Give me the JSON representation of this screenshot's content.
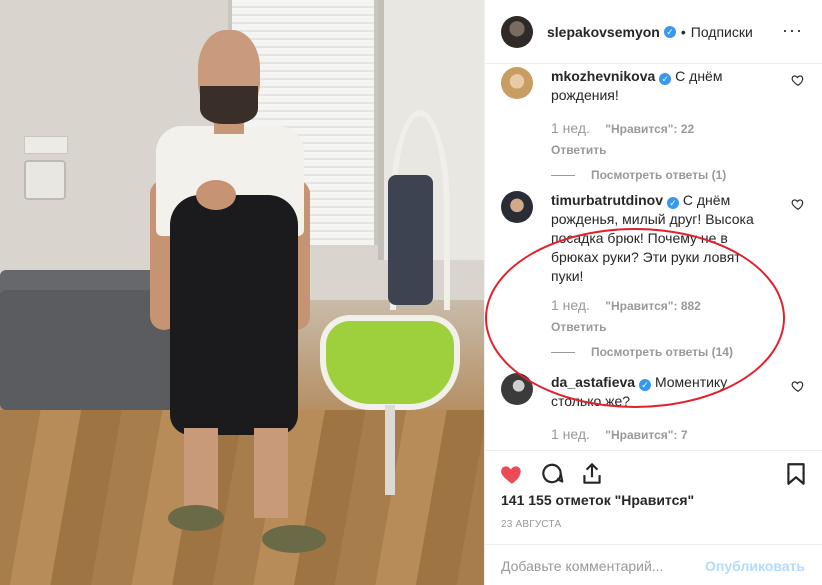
{
  "post": {
    "author": "slepakovsemyon",
    "follow_label": "Подписки",
    "dot": "•",
    "more": "···"
  },
  "comments": [
    {
      "username": "mkozhevnikova",
      "verified": true,
      "text": "С днём рождения!",
      "time": "1 нед.",
      "likes": "\"Нравится\": 22",
      "reply": "Ответить",
      "view_replies": "Посмотреть ответы (1)"
    },
    {
      "username": "timurbatrutdinov",
      "verified": true,
      "text": "С днём рожденья, милый друг! Высока посадка брюк! Почему не в брюках руки? Эти руки ловят пуки!",
      "time": "1 нед.",
      "likes": "\"Нравится\": 882",
      "reply": "Ответить",
      "view_replies": "Посмотреть ответы (14)"
    },
    {
      "username": "da_astafieva",
      "verified": true,
      "text": "Моментику столько же?",
      "time": "1 нед.",
      "likes": "\"Нравится\": 7"
    }
  ],
  "likes_total": "141 155 отметок \"Нравится\"",
  "date": "23 АВГУСТА",
  "add_comment": {
    "placeholder": "Добавьте комментарий...",
    "publish": "Опубликовать"
  },
  "colors": {
    "heart": "#ed4956",
    "verified": "#3897f0",
    "annotation": "#e0222c",
    "publish": "#b3dbff"
  }
}
